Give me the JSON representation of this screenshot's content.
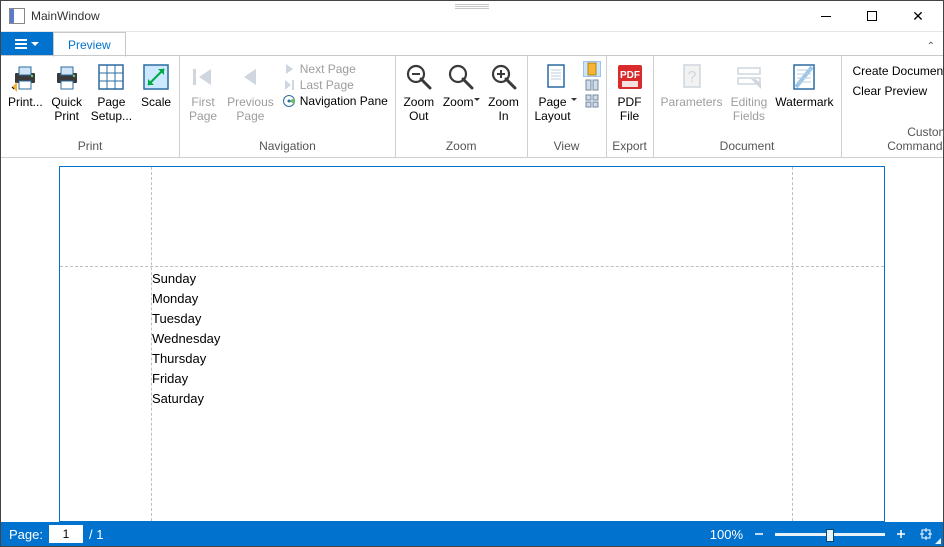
{
  "title": "MainWindow",
  "tabs": {
    "preview": "Preview"
  },
  "ribbon": {
    "print": {
      "label": "Print",
      "print": "Print...",
      "quick": "Quick\nPrint",
      "setup": "Page\nSetup...",
      "scale": "Scale"
    },
    "navigation": {
      "label": "Navigation",
      "first": "First\nPage",
      "prev": "Previous\nPage",
      "next": "Next Page",
      "last": "Last Page",
      "pane": "Navigation Pane"
    },
    "zoom": {
      "label": "Zoom",
      "out": "Zoom\nOut",
      "zoom": "Zoom",
      "in": "Zoom\nIn"
    },
    "view": {
      "label": "View",
      "layout": "Page\nLayout"
    },
    "export": {
      "label": "Export",
      "pdf": "PDF\nFile"
    },
    "document": {
      "label": "Document",
      "params": "Parameters",
      "fields": "Editing\nFields",
      "watermark": "Watermark"
    },
    "custom": {
      "label": "Custom Commands",
      "create": "Create Document",
      "clear": "Clear Preview"
    }
  },
  "status": {
    "page_label": "Page:",
    "current_page": "1",
    "total_pages": "/ 1",
    "zoom_pct": "100%"
  },
  "doc_lines": [
    "Sunday",
    "Monday",
    "Tuesday",
    "Wednesday",
    "Thursday",
    "Friday",
    "Saturday"
  ]
}
